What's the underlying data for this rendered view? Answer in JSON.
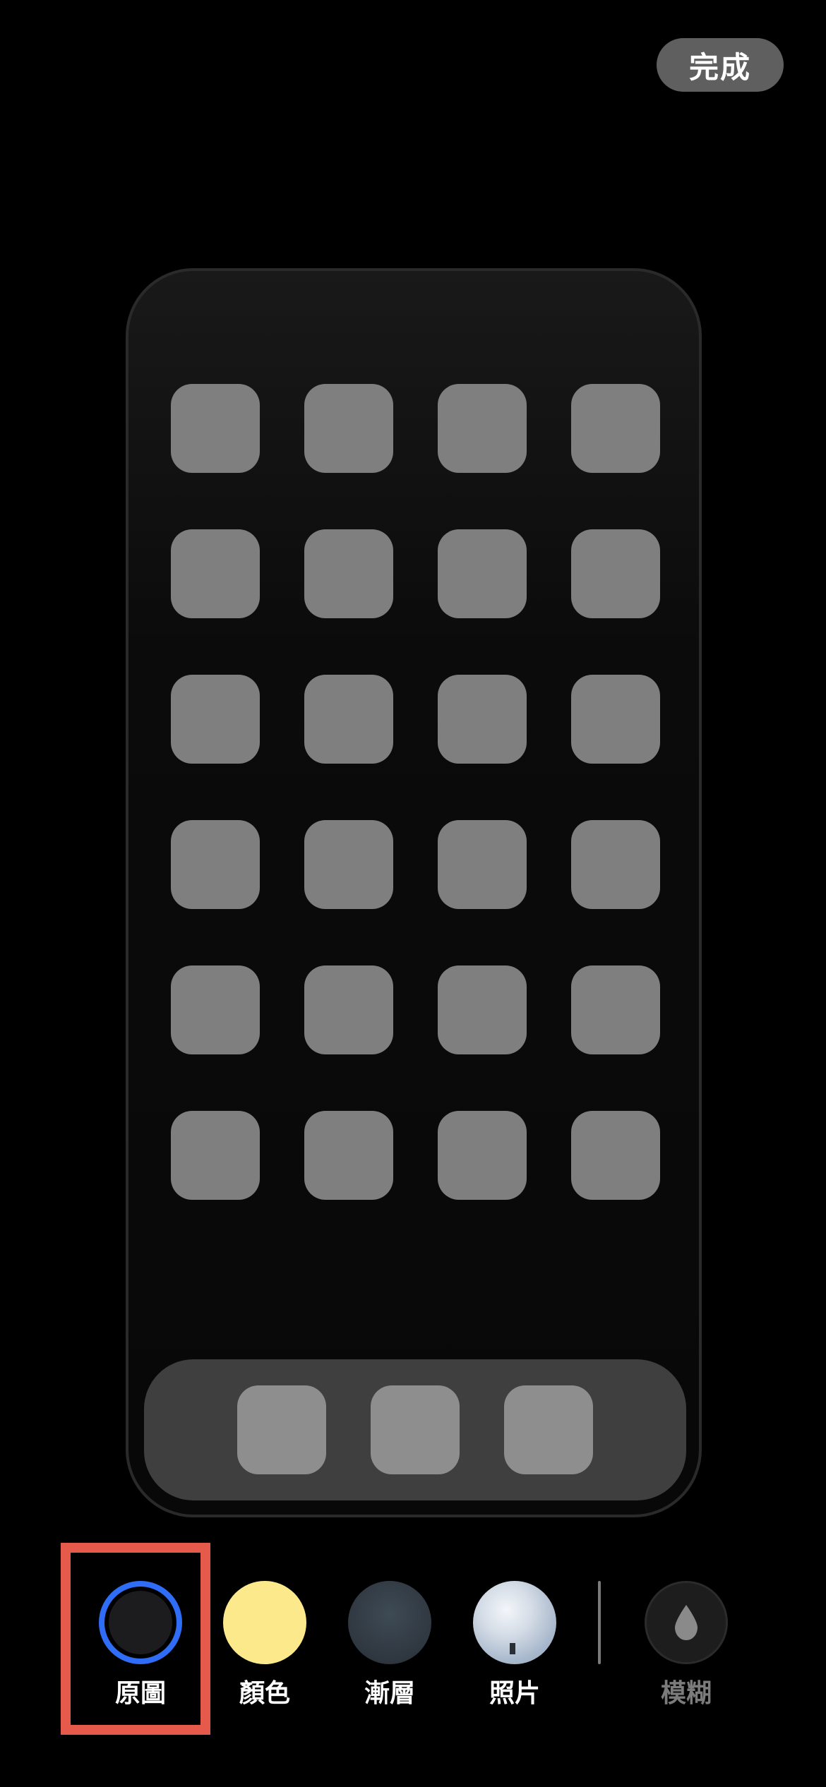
{
  "header": {
    "done_label": "完成"
  },
  "home_preview": {
    "grid_rows": 6,
    "grid_columns": 4,
    "dock_icon_count": 3
  },
  "wallpaper_options": [
    {
      "id": "original",
      "label": "原圖",
      "selected": true,
      "icon": "original-swatch-icon"
    },
    {
      "id": "color",
      "label": "顏色",
      "selected": false,
      "icon": "color-swatch-icon",
      "color": "#fbe98c"
    },
    {
      "id": "gradient",
      "label": "漸層",
      "selected": false,
      "icon": "gradient-swatch-icon"
    },
    {
      "id": "photo",
      "label": "照片",
      "selected": false,
      "icon": "photo-swatch-icon"
    },
    {
      "id": "blur",
      "label": "模糊",
      "selected": false,
      "icon": "blur-drop-icon",
      "disabled_look": true
    }
  ],
  "colors": {
    "background": "#000000",
    "selection_ring": "#2f6df6",
    "annotation_highlight": "#e55a4a",
    "app_icon": "#7f7f7f",
    "dock": "#3f3f3f"
  }
}
